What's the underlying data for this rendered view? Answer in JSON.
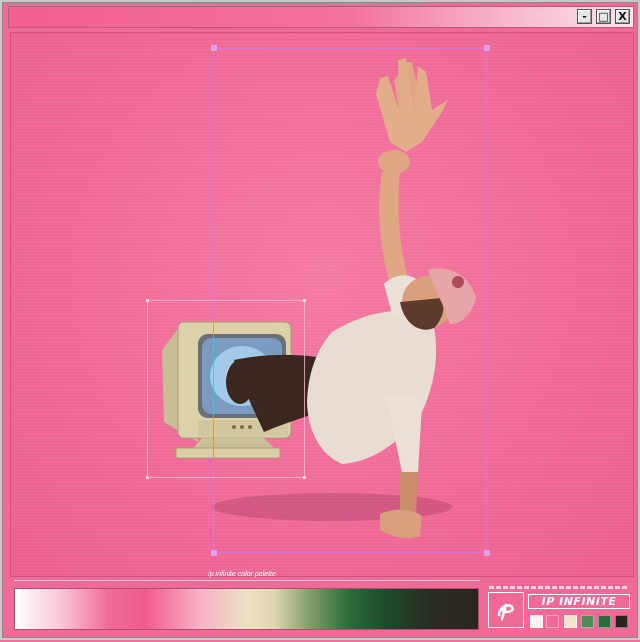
{
  "window": {
    "minimize_label": "-",
    "maximize_label": "□",
    "close_label": "X"
  },
  "palette": {
    "caption": "ip infinite color palette",
    "brand_name": "IP INFINITE",
    "swatches": [
      "#fbf4ef",
      "#f5e4c9",
      "#4f8a59",
      "#2e6a3c",
      "#2a241f"
    ]
  },
  "colors": {
    "background_pink": "#f06a97",
    "selection": "#d27ae6"
  }
}
